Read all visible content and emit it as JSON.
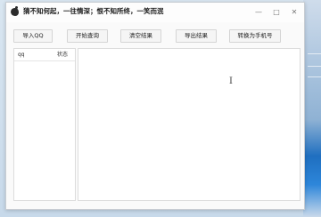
{
  "window": {
    "title": "猜不知何起，一往情深；恨不知所终，一笑而泯",
    "controls": {
      "minimize": "—",
      "maximize": "□",
      "close": "✕"
    }
  },
  "toolbar": {
    "import_qq": "导入QQ",
    "start_query": "开始查询",
    "clear_results": "清空结果",
    "export_results": "导出结果",
    "convert_phone": "转换为手机号"
  },
  "qq_list": {
    "columns": [
      "qq",
      "状态"
    ],
    "rows": []
  },
  "results": {
    "content": ""
  }
}
